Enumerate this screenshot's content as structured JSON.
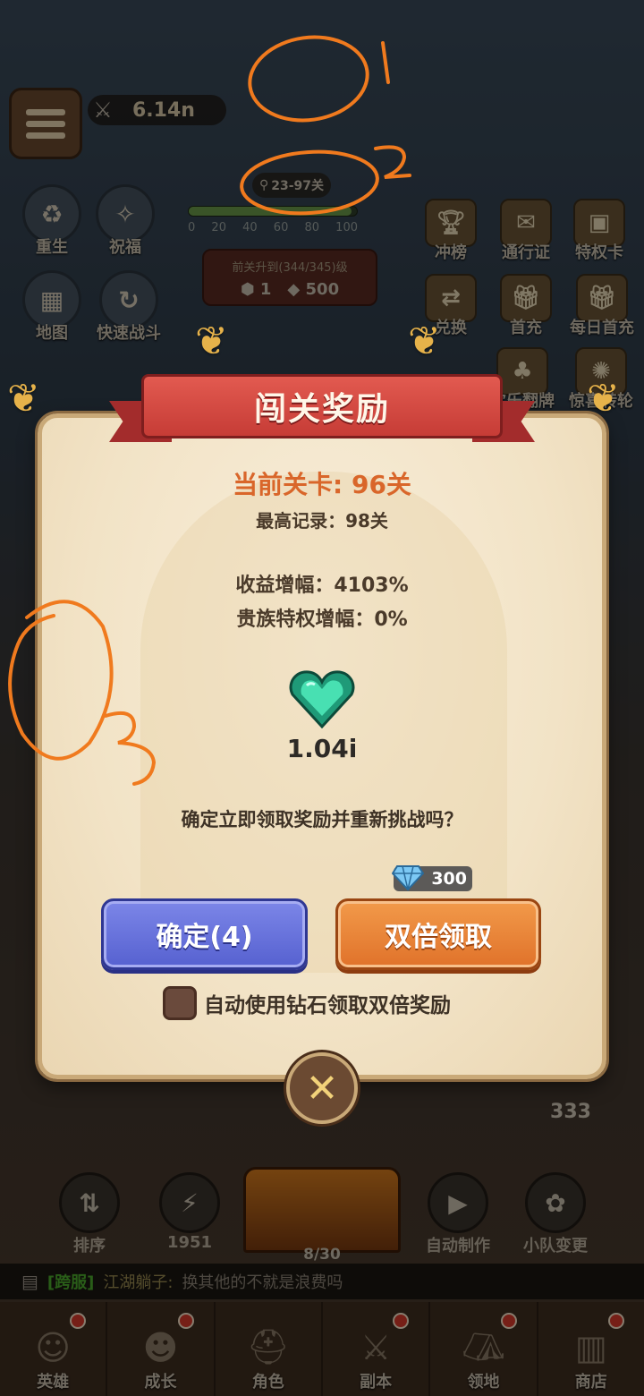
{
  "hud": {
    "power": "6.14n",
    "stage_range": "23-97关",
    "progress_ticks": [
      "0",
      "20",
      "40",
      "60",
      "80",
      "100"
    ],
    "progress_fraction": 0.97,
    "boss_text": "前关升到(344/345)级",
    "boss_gems": "1",
    "boss_diamonds": "500",
    "left_buttons": [
      {
        "label": "重生",
        "icon": "rebirth-icon"
      },
      {
        "label": "祝福",
        "icon": "blessing-icon"
      },
      {
        "label": "地图",
        "icon": "map-icon"
      },
      {
        "label": "快速战斗",
        "icon": "quick-battle-icon"
      }
    ],
    "right_buttons": [
      {
        "label": "冲榜",
        "icon": "trophy-icon"
      },
      {
        "label": "通行证",
        "icon": "pass-icon"
      },
      {
        "label": "特权卡",
        "icon": "privilege-card-icon"
      },
      {
        "label": "兑换",
        "icon": "exchange-icon"
      },
      {
        "label": "首充",
        "icon": "gift-icon"
      },
      {
        "label": "每日首充",
        "icon": "daily-gift-icon"
      },
      {
        "label": "欢乐翻牌",
        "icon": "flip-card-icon"
      },
      {
        "label": "惊喜转轮",
        "icon": "wheel-icon"
      }
    ]
  },
  "dialog": {
    "title": "闯关奖励",
    "current_stage": "当前关卡: 96关",
    "best_record": "最高记录：98关",
    "income_bonus": "收益增幅：4103%",
    "noble_bonus": "贵族特权增幅：0%",
    "reward_icon": "green-heart-gem-icon",
    "reward_amount": "1.04i",
    "question": "确定立即领取奖励并重新挑战吗？",
    "double_cost": "300",
    "confirm_label": "确定(4)",
    "double_label": "双倍领取",
    "auto_label": "自动使用钻石领取双倍奖励",
    "auto_checked": false,
    "close_icon": "close-icon"
  },
  "lower": {
    "counter": "333",
    "sort_label": "排序",
    "energy_value": "1951",
    "anvil_count": "8/30",
    "auto_craft_label": "自动制作",
    "squad_change_label": "小队变更"
  },
  "chat": {
    "channel": "[跨服]",
    "sender": "江湖躺子:",
    "message": "换其他的不就是浪费吗"
  },
  "tabs": [
    {
      "label": "英雄",
      "icon": "hero-icon",
      "badge": true
    },
    {
      "label": "成长",
      "icon": "growth-icon",
      "badge": true
    },
    {
      "label": "角色",
      "icon": "helmet-icon",
      "badge": false
    },
    {
      "label": "副本",
      "icon": "crossed-swords-icon",
      "badge": true
    },
    {
      "label": "领地",
      "icon": "territory-icon",
      "badge": true
    },
    {
      "label": "商店",
      "icon": "shop-chest-icon",
      "badge": true
    }
  ],
  "annotations": [
    "1",
    "2",
    "3"
  ],
  "colors": {
    "confirm_blue": "#5661d0",
    "double_orange": "#e0722a",
    "stage_orange": "#d9662a",
    "banner_red": "#c63c36",
    "annotation_orange": "#f07a1e"
  }
}
